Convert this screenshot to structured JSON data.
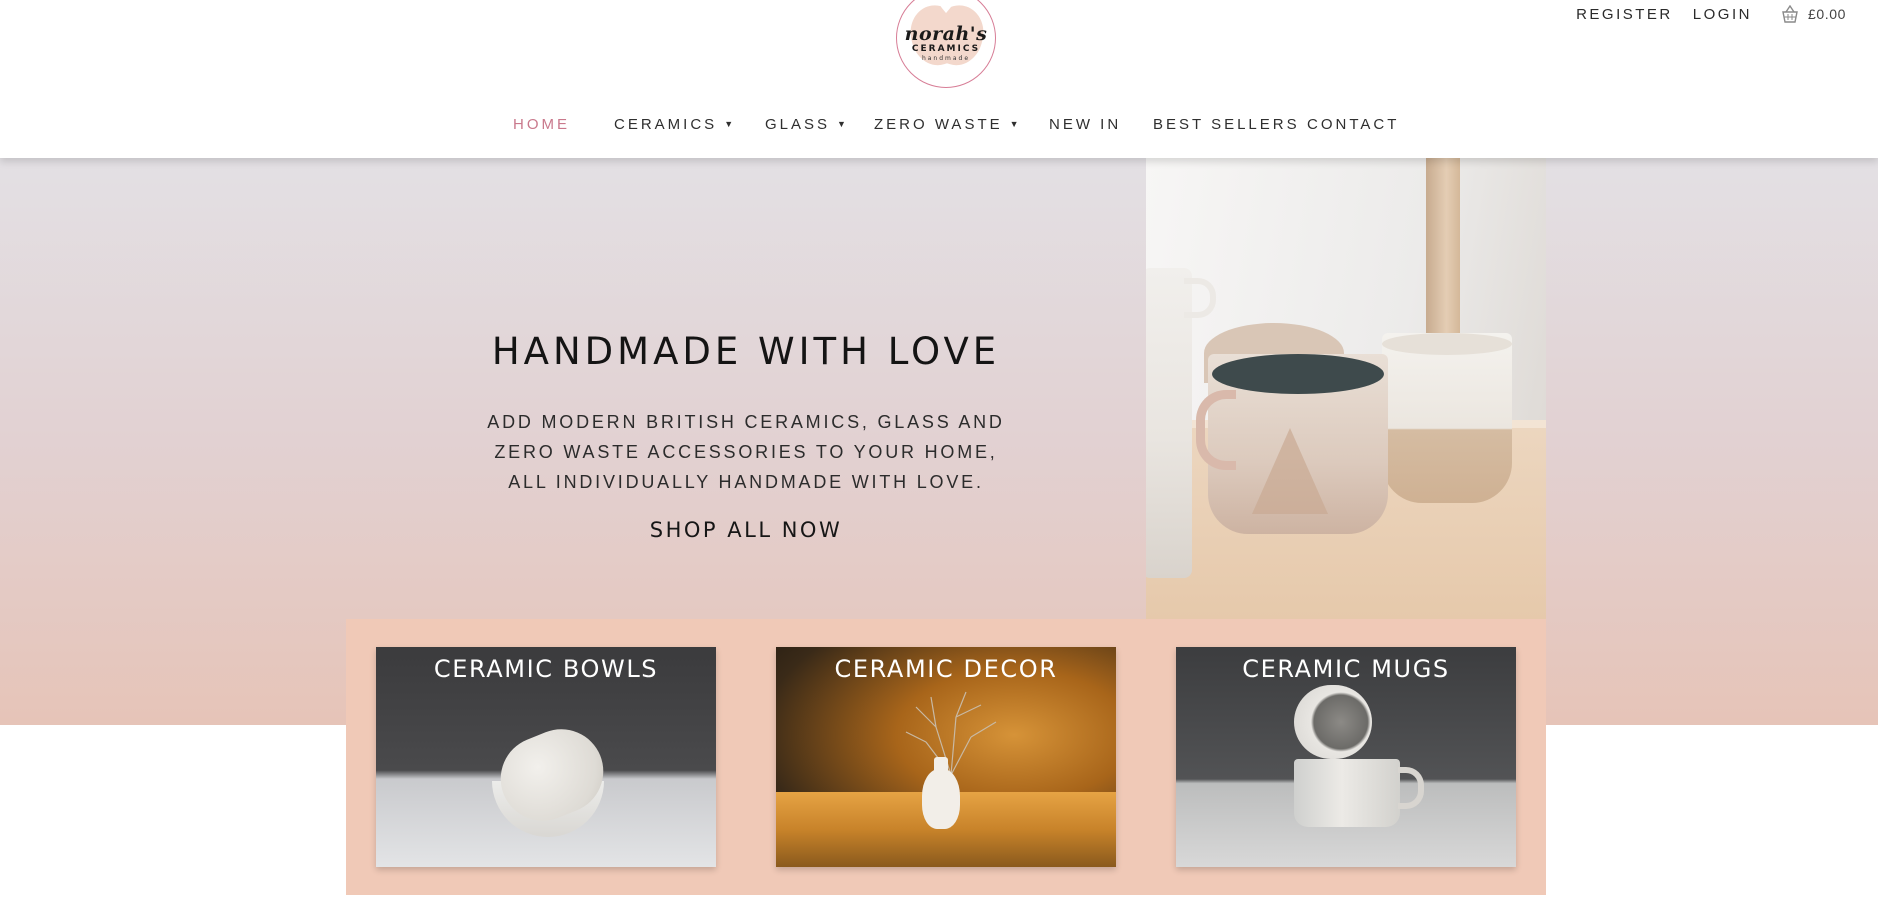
{
  "header": {
    "logo": {
      "name": "norah's",
      "sub": "CERAMICS",
      "tag": "handmade"
    },
    "top_links": {
      "register": "REGISTER",
      "login": "LOGIN",
      "cart_total": "£0.00",
      "cart_icon": "basket-icon"
    },
    "nav": {
      "items": [
        {
          "label": "HOME",
          "active": true,
          "dropdown": false
        },
        {
          "label": "CERAMICS",
          "active": false,
          "dropdown": true
        },
        {
          "label": "GLASS",
          "active": false,
          "dropdown": true
        },
        {
          "label": "ZERO WASTE",
          "active": false,
          "dropdown": true
        },
        {
          "label": "NEW IN",
          "active": false,
          "dropdown": false
        },
        {
          "label": "BEST SELLERS",
          "active": false,
          "dropdown": false
        },
        {
          "label": "CONTACT",
          "active": false,
          "dropdown": false
        }
      ],
      "dropdown_glyph": "▼"
    }
  },
  "hero": {
    "title": "HANDMADE WITH LOVE",
    "text_lines": [
      "ADD MODERN BRITISH CERAMICS, GLASS AND",
      "ZERO WASTE ACCESSORIES TO YOUR HOME,",
      "ALL INDIVIDUALLY HANDMADE WITH LOVE."
    ],
    "cta": "SHOP ALL NOW"
  },
  "categories": [
    {
      "title": "CERAMIC BOWLS"
    },
    {
      "title": "CERAMIC DECOR"
    },
    {
      "title": "CERAMIC MUGS"
    }
  ],
  "colors": {
    "accent_pink": "#c9798c",
    "panel_peach": "#f0c9b7",
    "logo_ring": "#d77d96"
  }
}
